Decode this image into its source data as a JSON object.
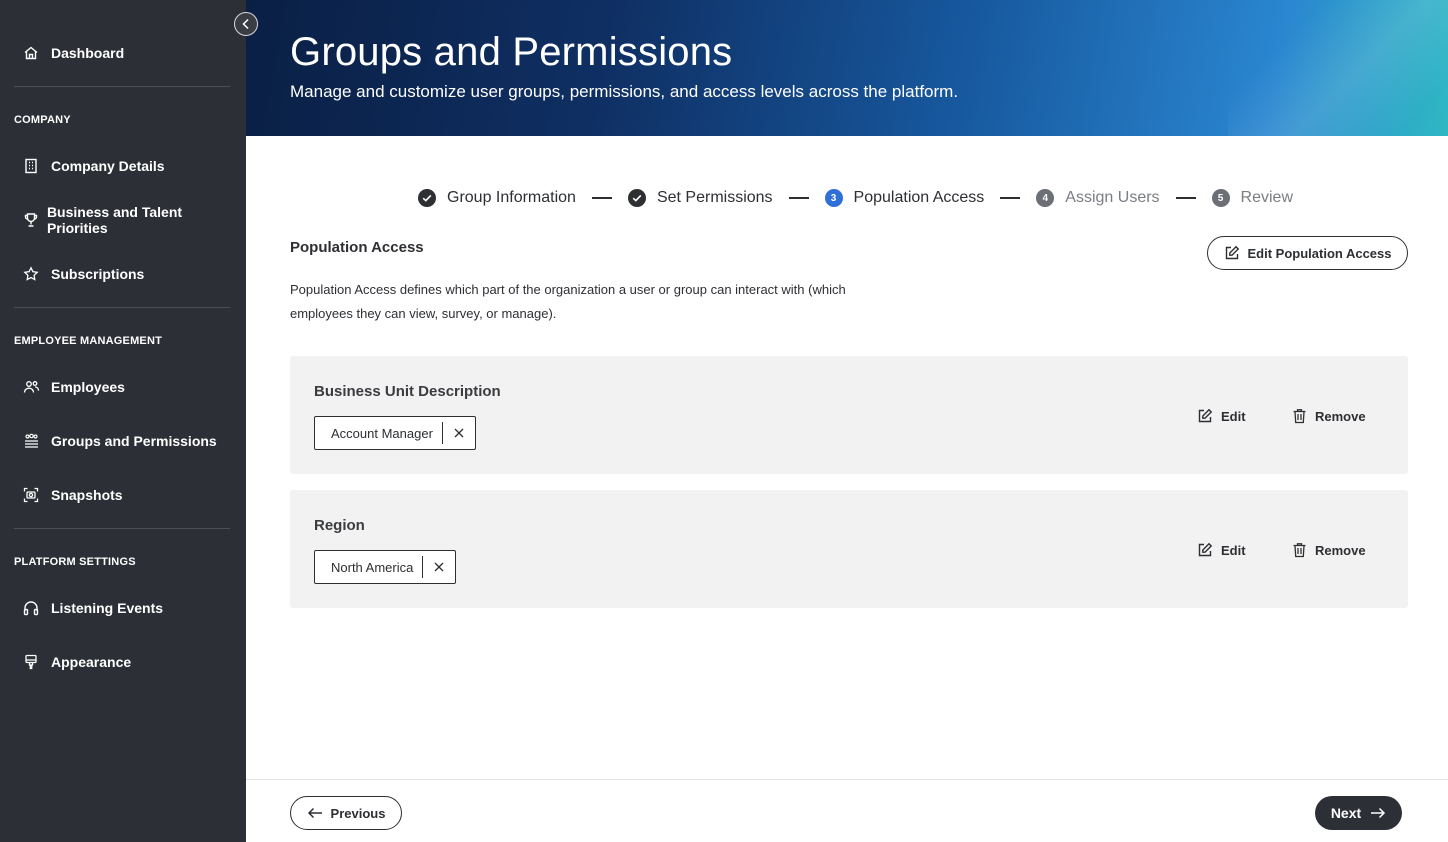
{
  "sidebar": {
    "dashboard": "Dashboard",
    "sections": {
      "company": "COMPANY",
      "employee_management": "EMPLOYEE MANAGEMENT",
      "platform_settings": "PLATFORM SETTINGS"
    },
    "items": [
      {
        "label": "Company Details",
        "icon": "building-icon"
      },
      {
        "label": "Business and Talent Priorities",
        "icon": "trophy-icon"
      },
      {
        "label": "Subscriptions",
        "icon": "star-icon"
      },
      {
        "label": "Employees",
        "icon": "people-icon"
      },
      {
        "label": "Groups and Permissions",
        "icon": "group-permissions-icon"
      },
      {
        "label": "Snapshots",
        "icon": "snapshot-icon"
      },
      {
        "label": "Listening Events",
        "icon": "headphones-icon"
      },
      {
        "label": "Appearance",
        "icon": "paint-brush-icon"
      }
    ]
  },
  "header": {
    "title": "Groups and Permissions",
    "subtitle": "Manage and customize user groups, permissions, and access levels across the platform."
  },
  "stepper": {
    "steps": [
      {
        "label": "Group Information",
        "state": "done"
      },
      {
        "label": "Set Permissions",
        "state": "done"
      },
      {
        "number": "3",
        "label": "Population Access",
        "state": "active"
      },
      {
        "number": "4",
        "label": "Assign Users",
        "state": "todo"
      },
      {
        "number": "5",
        "label": "Review",
        "state": "todo"
      }
    ]
  },
  "section": {
    "title": "Population Access",
    "description": "Population Access defines which part of the organization a user or group can interact with (which employees they can view, survey, or manage).",
    "edit_button": "Edit Population Access"
  },
  "cards": [
    {
      "title": "Business Unit Description",
      "chip": "Account Manager",
      "edit": "Edit",
      "remove": "Remove"
    },
    {
      "title": "Region",
      "chip": "North America",
      "edit": "Edit",
      "remove": "Remove"
    }
  ],
  "footer": {
    "previous": "Previous",
    "next": "Next"
  },
  "colors": {
    "sidebar_bg": "#2c2f36",
    "active_step": "#2f6fd8",
    "card_bg": "#f2f2f2"
  }
}
